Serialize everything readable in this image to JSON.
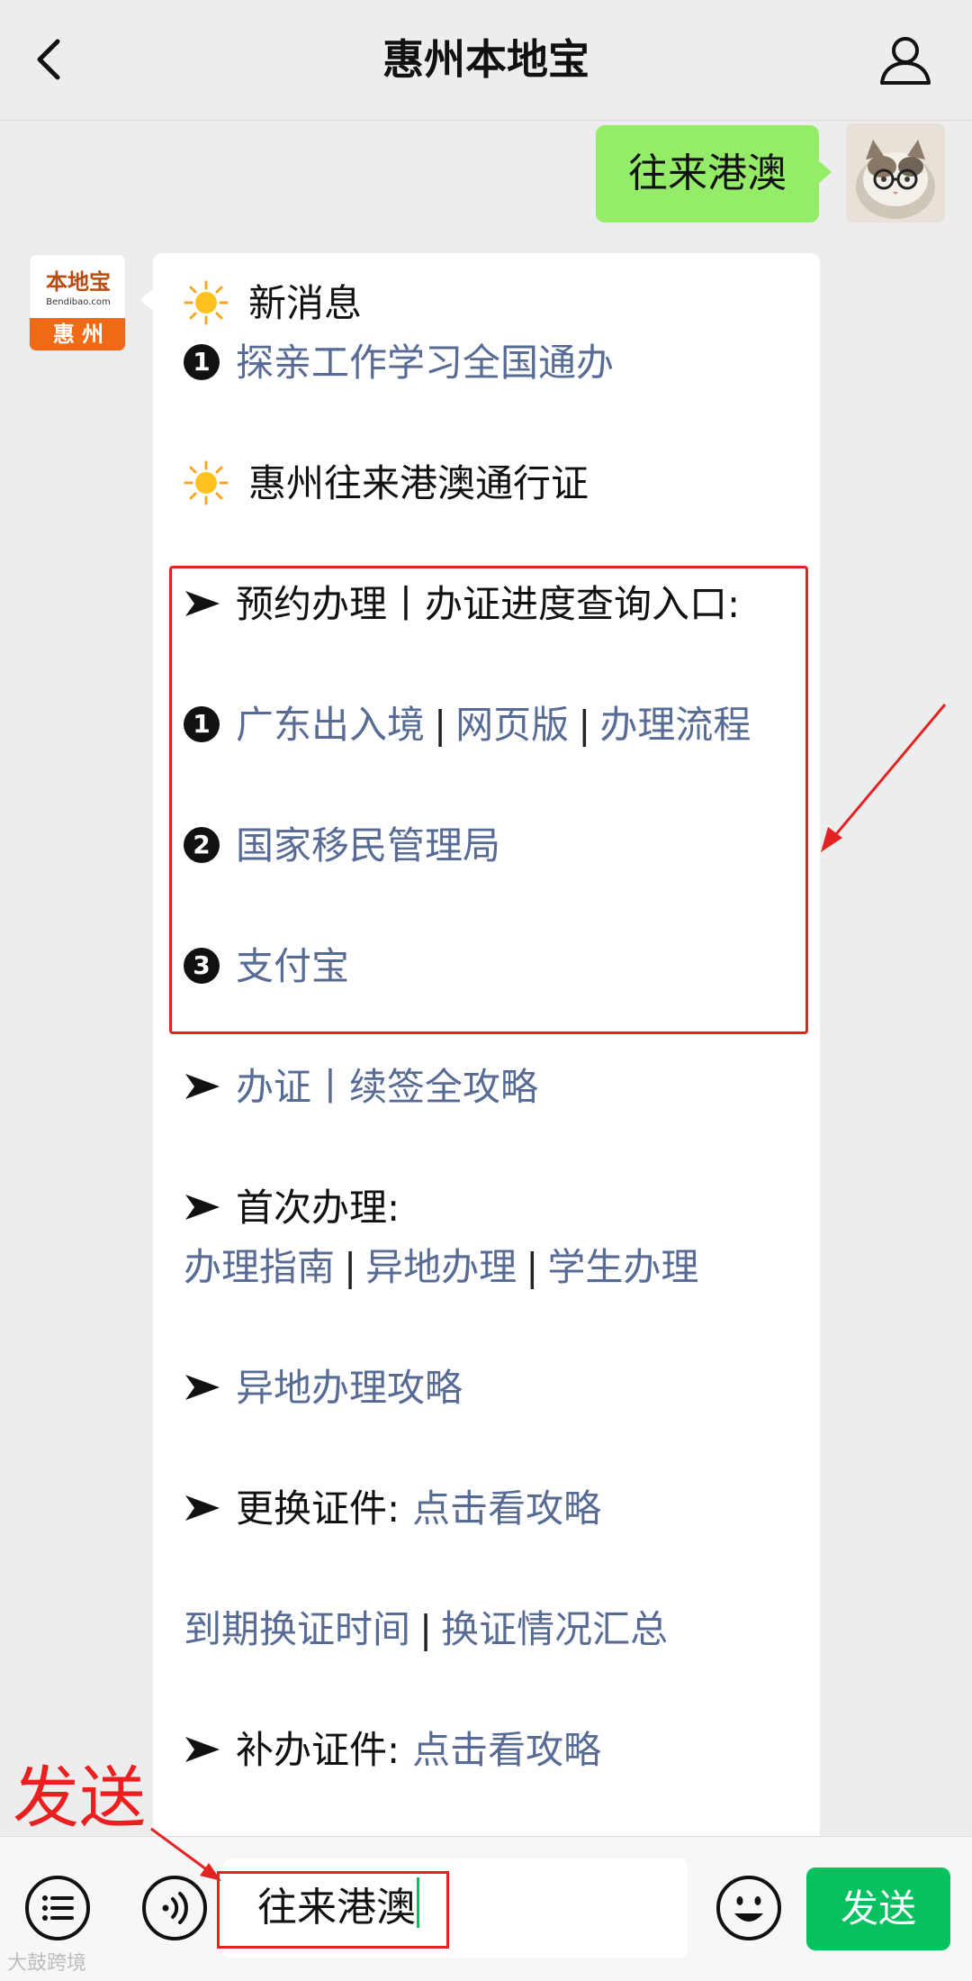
{
  "header": {
    "title": "惠州本地宝"
  },
  "outgoing": {
    "text": "往来港澳"
  },
  "account_avatar": {
    "logo_text": "本地宝",
    "logo_sub": "Bendibao.com",
    "city": "惠 州"
  },
  "reply": {
    "new_msg_label": "新消息",
    "new_msg_link_num": "1",
    "new_msg_link": "探亲工作学习全国通办",
    "section_title": "惠州往来港澳通行证",
    "appointment_label": "预约办理丨办证进度查询入口:",
    "appointment_links": [
      {
        "num": "1",
        "parts": [
          "广东出入境",
          "网页版",
          "办理流程"
        ]
      },
      {
        "num": "2",
        "parts": [
          "国家移民管理局"
        ]
      },
      {
        "num": "3",
        "parts": [
          "支付宝"
        ]
      }
    ],
    "guide_link": "办证丨续签全攻略",
    "first_time_label": "首次办理:",
    "first_time_links": [
      "办理指南",
      "异地办理",
      "学生办理"
    ],
    "remote_link": "异地办理攻略",
    "replace_label": "更换证件:",
    "replace_link": "点击看攻略",
    "expiry_links": [
      "到期换证时间",
      "换证情况汇总"
    ],
    "reissue_label": "补办证件:",
    "reissue_link": "点击看攻略"
  },
  "input_bar": {
    "input_value": "往来港澳",
    "send_label": "发送"
  },
  "annotation": {
    "label": "发送"
  },
  "watermark": "大鼓跨境",
  "colors": {
    "link": "#576b95",
    "bubble_out": "#95ec69",
    "send_green": "#07c160",
    "annotation_red": "#e32222"
  }
}
